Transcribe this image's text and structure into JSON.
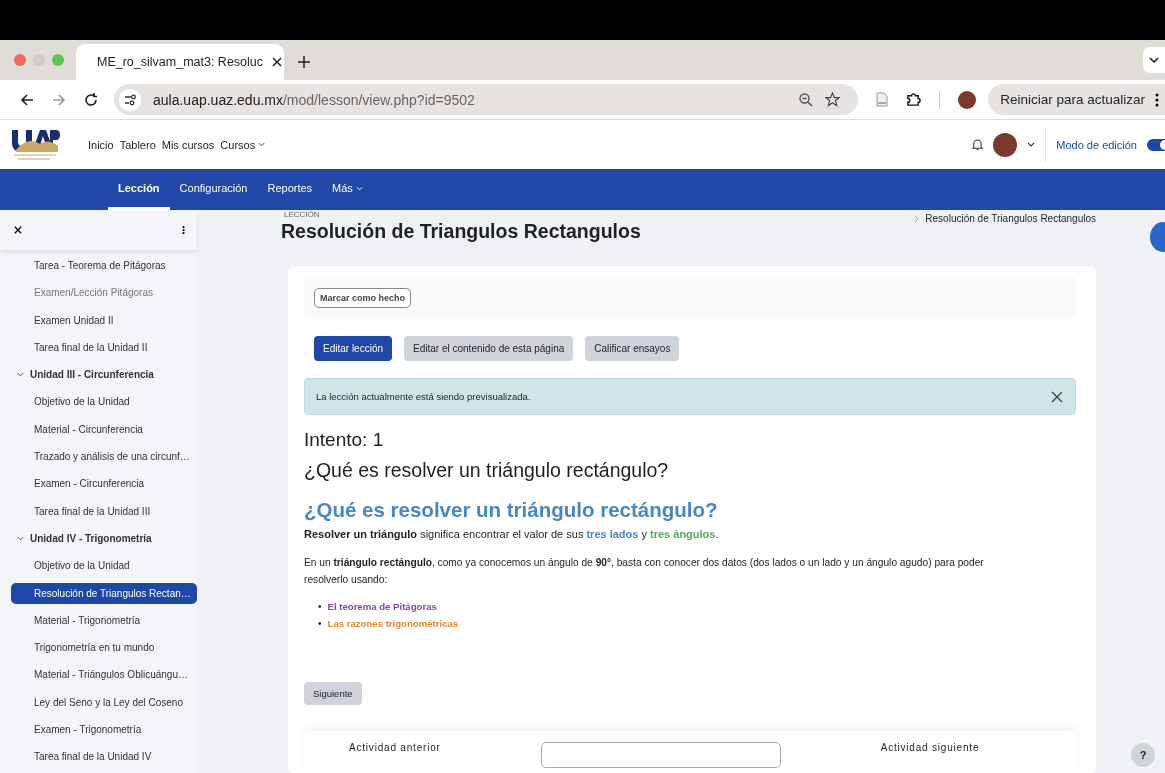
{
  "browser": {
    "tab_title": "ME_ro_silvam_mat3: Resoluc",
    "url_host": "aula.uap.uaz.edu.mx",
    "url_path": "/mod/lesson/view.php?id=9502",
    "update_button": "Reiniciar para actualizar"
  },
  "navbar": {
    "links": [
      {
        "label": "Inicio",
        "dropdown": false
      },
      {
        "label": "Tablero",
        "dropdown": false
      },
      {
        "label": "Mis cursos",
        "dropdown": false
      },
      {
        "label": "Cursos",
        "dropdown": true
      }
    ],
    "edit_mode_label": "Modo de edición",
    "edit_mode_on": true
  },
  "secondary_nav": [
    {
      "label": "Lección",
      "selected": true,
      "dropdown": false
    },
    {
      "label": "Configuración",
      "selected": false,
      "dropdown": false
    },
    {
      "label": "Reportes",
      "selected": false,
      "dropdown": false
    },
    {
      "label": "Más",
      "selected": false,
      "dropdown": true
    }
  ],
  "sidebar": {
    "items": [
      {
        "label": "Tarea - Teorema de Pitágoras",
        "selected": false,
        "dimmed": false
      },
      {
        "label": "Examen/Lección Pitágoras",
        "selected": false,
        "dimmed": true
      },
      {
        "label": "Examen Unidad II",
        "selected": false,
        "dimmed": false
      },
      {
        "label": "Tarea final de la Unidad II",
        "selected": false,
        "dimmed": false
      },
      {
        "label": "Unidad III - Circunferencia",
        "kind": "section",
        "expanded": true,
        "children": [
          {
            "label": "Objetivo de la Unidad",
            "selected": false,
            "dimmed": false
          },
          {
            "label": "Material - Circunferencia",
            "selected": false,
            "dimmed": false
          },
          {
            "label": "Trazado y análisis de una circunf…",
            "selected": false,
            "dimmed": false
          },
          {
            "label": "Examen - Circunferencia",
            "selected": false,
            "dimmed": false
          },
          {
            "label": "Tarea final de la Unidad III",
            "selected": false,
            "dimmed": false
          }
        ]
      },
      {
        "label": "Unidad IV - Trigonometría",
        "kind": "section",
        "expanded": true,
        "children": [
          {
            "label": "Objetivo de la Unidad",
            "selected": false,
            "dimmed": false
          },
          {
            "label": "Resolución de Triangulos Rectan…",
            "selected": true,
            "dimmed": false
          },
          {
            "label": "Material - Trigonometría",
            "selected": false,
            "dimmed": false
          },
          {
            "label": "Trigonometría en tu mundo",
            "selected": false,
            "dimmed": false
          },
          {
            "label": "Material - Triángulos Oblicuángu…",
            "selected": false,
            "dimmed": false
          },
          {
            "label": "Ley del Seno y la Ley del Coseno",
            "selected": false,
            "dimmed": false
          },
          {
            "label": "Examen - Trigonometría",
            "selected": false,
            "dimmed": false
          },
          {
            "label": "Tarea final de la Unidad IV",
            "selected": false,
            "dimmed": false
          }
        ]
      }
    ]
  },
  "page_header": {
    "eyebrow": "LECCIÓN",
    "title": "Resolución de Triangulos Rectangulos",
    "breadcrumb": "Resolución de Triangulos Rectangulos"
  },
  "completion_button": "Marcar como hecho",
  "action_buttons": [
    {
      "label": "Editar lección",
      "kind": "primary"
    },
    {
      "label": "Editar el contenido de esta página",
      "kind": "secondary"
    },
    {
      "label": "Calificar ensayos",
      "kind": "secondary"
    }
  ],
  "alert": "La lección actualmente está siendo previsualizada.",
  "attempt": "Intento: 1",
  "page_title": "¿Qué es resolver un triángulo rectángulo?",
  "content": {
    "heading": "¿Qué es resolver un triángulo rectángulo?",
    "paragraph_1": [
      {
        "text": "Resolver un triángulo",
        "bold": true
      },
      {
        "text": " significa encontrar el valor de sus ",
        "bold": false
      },
      {
        "text": "tres lados",
        "bold": true,
        "color": "#4a86c0"
      },
      {
        "text": " y ",
        "bold": false
      },
      {
        "text": "tres ángulos",
        "bold": true,
        "color": "#58a85a"
      },
      {
        "text": ".",
        "bold": false
      }
    ],
    "paragraph_2": "En un **triángulo rectángulo**, como ya conocemos un ángulo de **90°**, basta con conocer dos datos (dos lados o un lado y un ángulo agudo) para poder resolverlo usando:",
    "list": [
      {
        "bullet": "•",
        "text": "El teorema de Pitágoras",
        "color": "#7d4aa8"
      },
      {
        "bullet": "•",
        "text": "Las razones trigonométricas",
        "color": "#e0872e"
      }
    ]
  },
  "next_button": "Siguiente",
  "activity_nav": {
    "previous": "Actividad anterior",
    "next": "Actividad siguiente"
  },
  "help_button": "?"
}
